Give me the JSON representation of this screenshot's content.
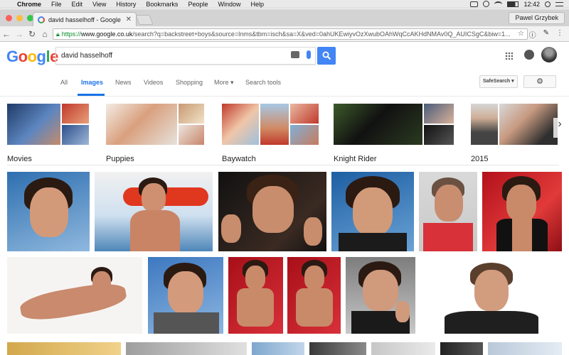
{
  "menubar": {
    "app": "Chrome",
    "items": [
      "File",
      "Edit",
      "View",
      "History",
      "Bookmarks",
      "People",
      "Window",
      "Help"
    ],
    "clock": "12:42"
  },
  "browser": {
    "tab_title": "david hasselhoff - Google Sea",
    "profile": "Pawel Grzybek",
    "url_scheme": "https://",
    "url_host": "www.google.co.uk",
    "url_path": "/search?q=backstreet+boys&source=lnms&tbm=isch&sa=X&ved=0ahUKEwiyvOzXwubOAhWqCcAKHdNMAv0Q_AUICSgC&biw=1..."
  },
  "google": {
    "query": "david hasselhoff",
    "logo_letters": [
      {
        "ch": "G",
        "color": "#4285f4"
      },
      {
        "ch": "o",
        "color": "#ea4335"
      },
      {
        "ch": "o",
        "color": "#fbbc05"
      },
      {
        "ch": "g",
        "color": "#4285f4"
      },
      {
        "ch": "l",
        "color": "#34a853"
      },
      {
        "ch": "e",
        "color": "#ea4335"
      }
    ]
  },
  "nav": {
    "all": "All",
    "images": "Images",
    "news": "News",
    "videos": "Videos",
    "shopping": "Shopping",
    "more": "More ▾",
    "search_tools": "Search tools",
    "safesearch": "SafeSearch ▾"
  },
  "related": [
    "Movies",
    "Puppies",
    "Baywatch",
    "Knight Rider",
    "2015"
  ],
  "colors": {
    "accent": "#1a73e8",
    "search_button": "#4285f4"
  }
}
